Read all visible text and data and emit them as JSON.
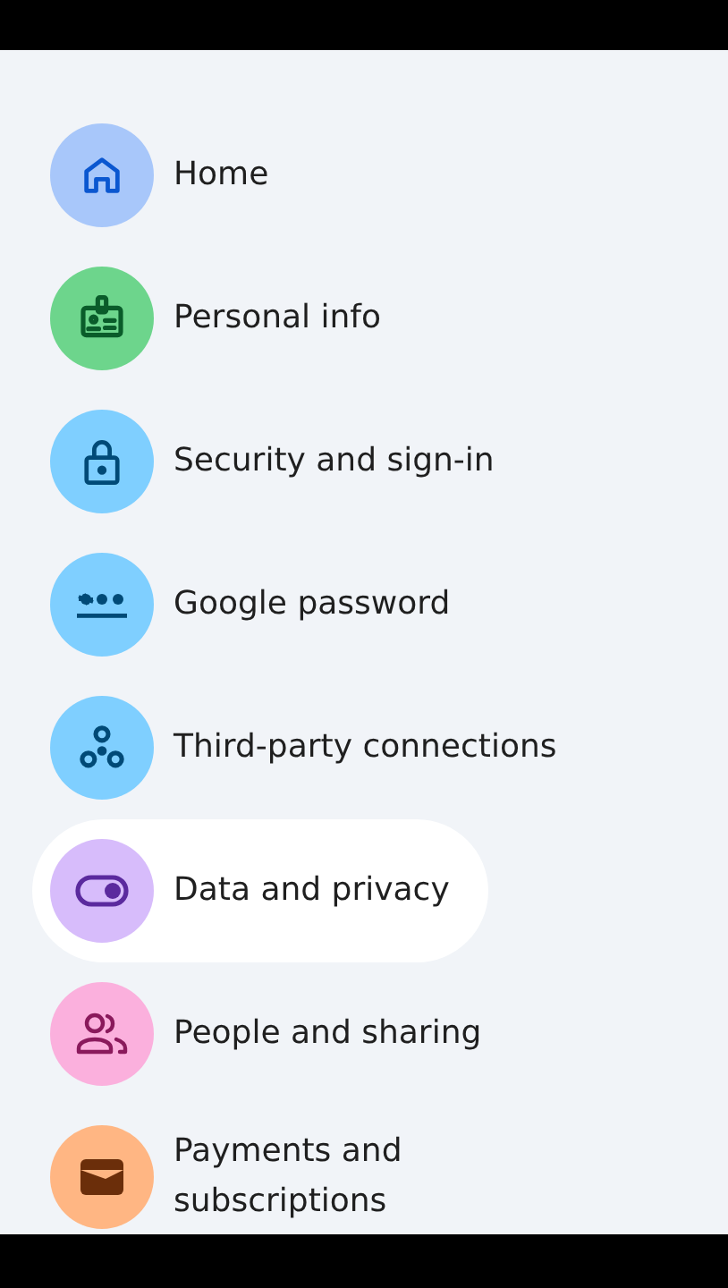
{
  "menu": [
    {
      "label": "Home",
      "kind": "home",
      "color": "#a8c7fa",
      "selected": false
    },
    {
      "label": "Personal info",
      "kind": "badge",
      "color": "#6dd58c",
      "selected": false
    },
    {
      "label": "Security and sign-in",
      "kind": "lock",
      "color": "#7fcfff",
      "selected": false
    },
    {
      "label": "Google password",
      "kind": "password",
      "color": "#7fcfff",
      "selected": false
    },
    {
      "label": "Third-party connections",
      "kind": "nodes",
      "color": "#7fcfff",
      "selected": false
    },
    {
      "label": "Data and privacy",
      "kind": "toggle",
      "color": "#d7bcfb",
      "selected": true
    },
    {
      "label": "People and sharing",
      "kind": "people",
      "color": "#fbb0dd",
      "selected": false
    },
    {
      "label": "Payments and subscriptions",
      "kind": "wallet",
      "color": "#ffb683",
      "selected": false
    }
  ]
}
